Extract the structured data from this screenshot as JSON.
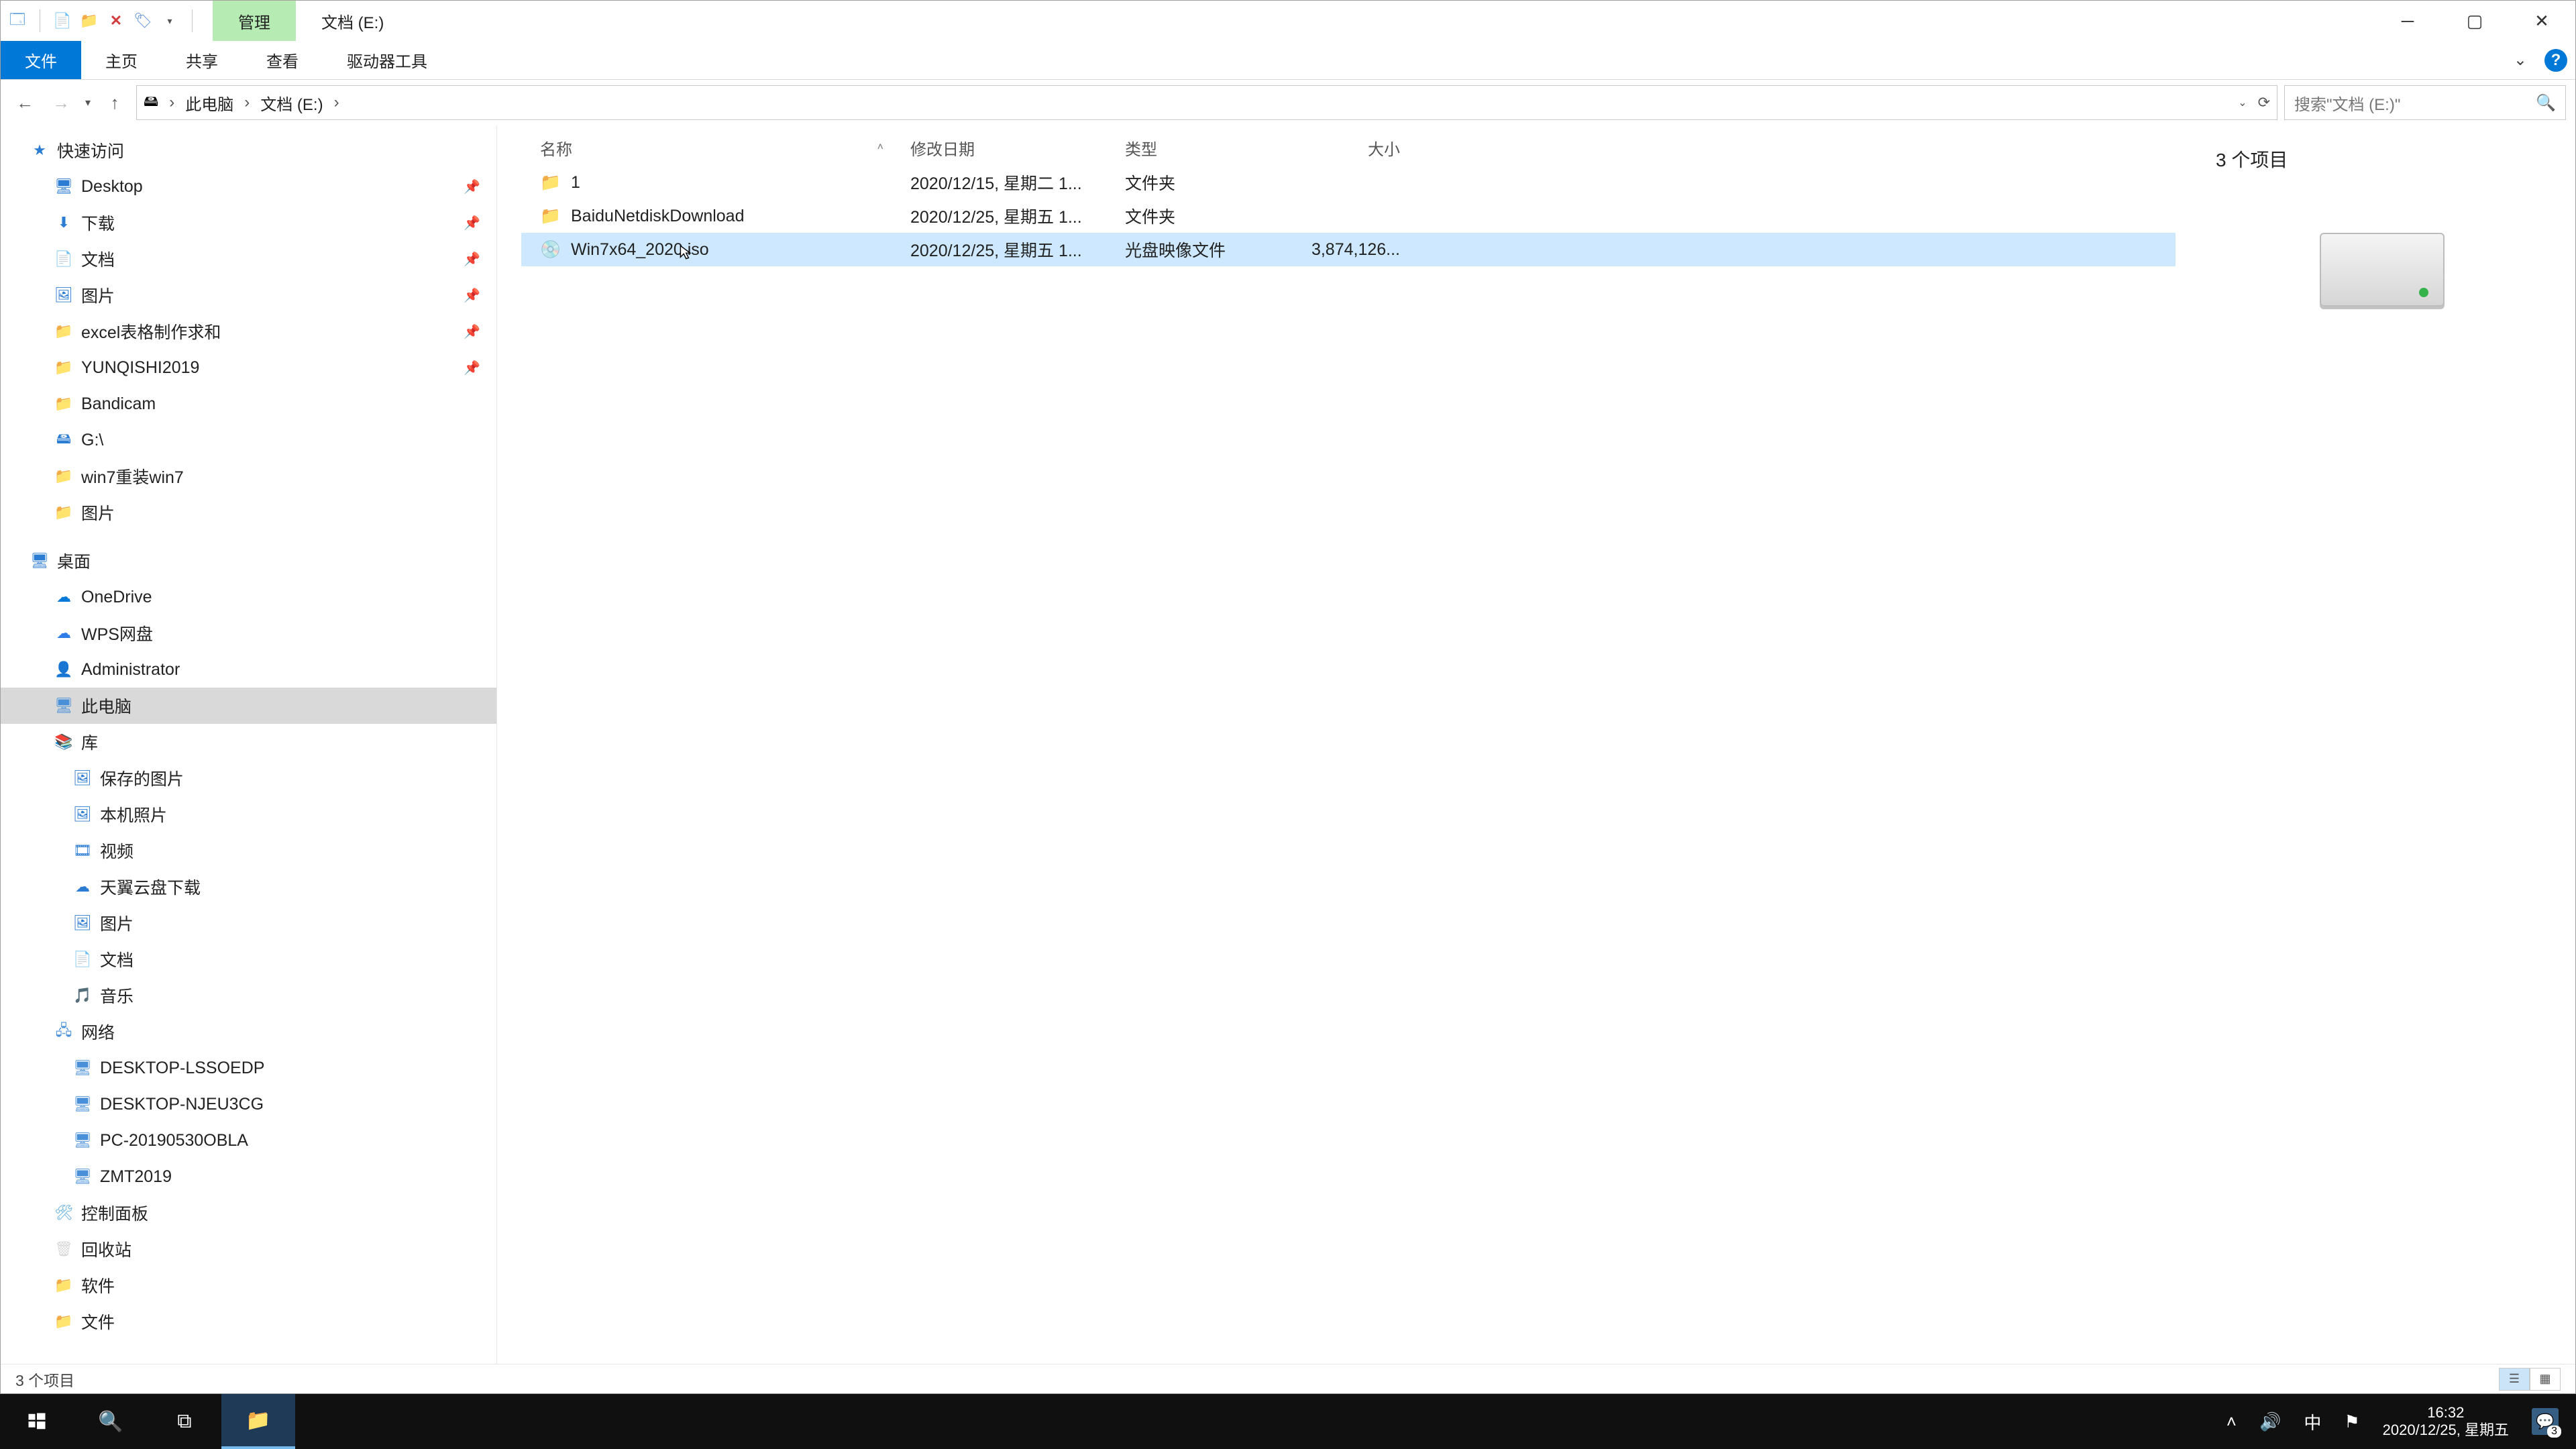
{
  "titlebar": {
    "contextual_tab": "管理",
    "window_title": "文档 (E:)"
  },
  "ribbon_tabs": {
    "file": "文件",
    "home": "主页",
    "share": "共享",
    "view": "查看",
    "drive_tools": "驱动器工具"
  },
  "address": {
    "crumb_thispc": "此电脑",
    "crumb_drive": "文档 (E:)"
  },
  "search": {
    "placeholder": "搜索\"文档 (E:)\""
  },
  "tree": {
    "quick_access": "快速访问",
    "desktop": "Desktop",
    "downloads": "下载",
    "documents": "文档",
    "pictures": "图片",
    "excel": "excel表格制作求和",
    "yunqishi": "YUNQISHI2019",
    "bandicam": "Bandicam",
    "gdrive": "G:\\",
    "win7reinst": "win7重装win7",
    "pictures2": "图片",
    "desktop_cn": "桌面",
    "onedrive": "OneDrive",
    "wps": "WPS网盘",
    "admin": "Administrator",
    "thispc": "此电脑",
    "libraries": "库",
    "saved_pictures": "保存的图片",
    "camera_roll": "本机照片",
    "videos": "视频",
    "tianyi": "天翼云盘下载",
    "pictures3": "图片",
    "documents2": "文档",
    "music": "音乐",
    "network": "网络",
    "pc1": "DESKTOP-LSSOEDP",
    "pc2": "DESKTOP-NJEU3CG",
    "pc3": "PC-20190530OBLA",
    "pc4": "ZMT2019",
    "control_panel": "控制面板",
    "recycle": "回收站",
    "software": "软件",
    "files": "文件"
  },
  "columns": {
    "name": "名称",
    "date": "修改日期",
    "type": "类型",
    "size": "大小"
  },
  "files": [
    {
      "name": "1",
      "date": "2020/12/15, 星期二 1...",
      "type": "文件夹",
      "size": "",
      "icon": "folder",
      "selected": false
    },
    {
      "name": "BaiduNetdiskDownload",
      "date": "2020/12/25, 星期五 1...",
      "type": "文件夹",
      "size": "",
      "icon": "folder",
      "selected": false
    },
    {
      "name": "Win7x64_2020.iso",
      "date": "2020/12/25, 星期五 1...",
      "type": "光盘映像文件",
      "size": "3,874,126...",
      "icon": "iso",
      "selected": true
    }
  ],
  "preview": {
    "title": "3 个项目"
  },
  "status": {
    "text": "3 个项目"
  },
  "taskbar": {
    "time": "16:32",
    "date": "2020/12/25, 星期五",
    "ime": "中",
    "notif_count": "3"
  }
}
